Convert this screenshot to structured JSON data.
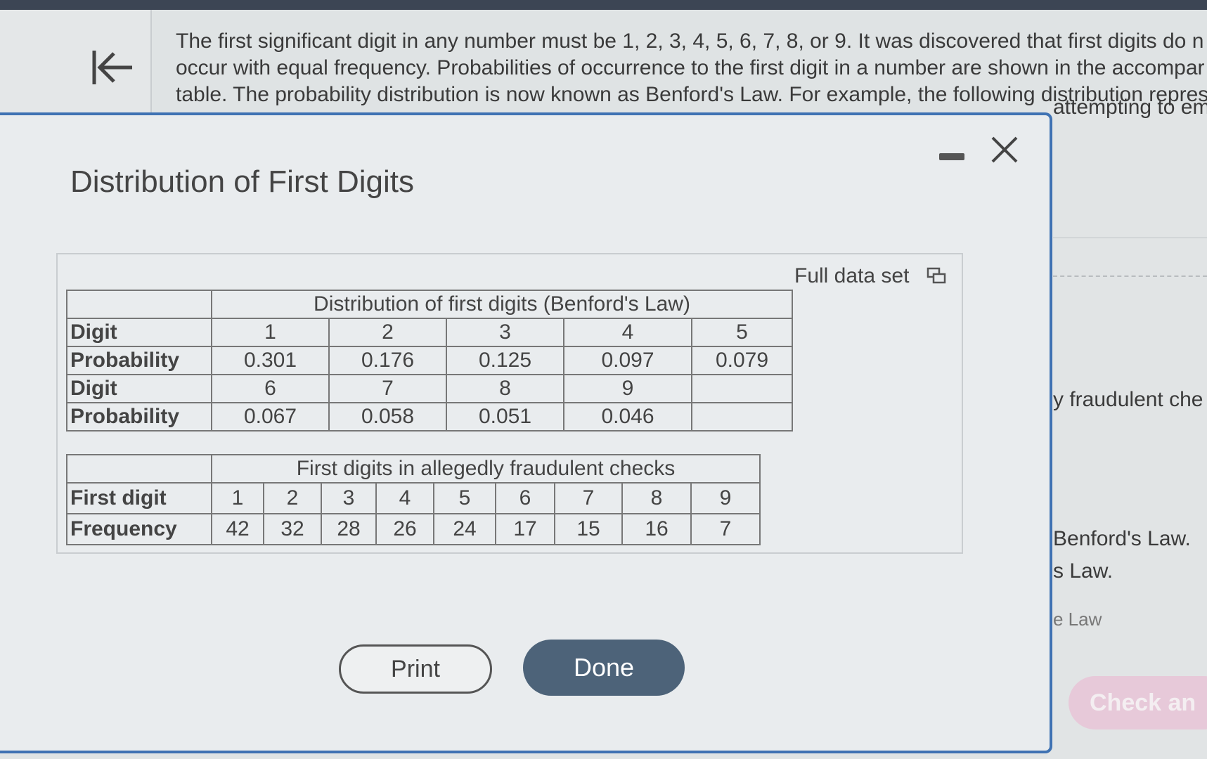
{
  "question": {
    "lines": [
      "The first significant digit in any number must be 1, 2, 3, 4, 5, 6, 7, 8, or 9. It was discovered that first digits do n",
      "occur with equal frequency. Probabilities of occurrence to the first digit in a number are shown in the accompar",
      "table. The probability distribution is now known as Benford's Law. For example, the following distribution repres"
    ]
  },
  "background_right": {
    "attempting": "attempting to em",
    "fraudulent": "y fraudulent che",
    "benford1": "Benford's Law.",
    "benford2": "s Law.",
    "benford3": "e Law",
    "check_button": "Check an"
  },
  "modal": {
    "title": "Distribution of First Digits",
    "full_data_set": "Full data set",
    "print_label": "Print",
    "done_label": "Done"
  },
  "benford_table": {
    "caption": "Distribution of first digits (Benford's Law)",
    "rows": [
      {
        "label": "Digit",
        "cells": [
          "1",
          "2",
          "3",
          "4",
          "5"
        ]
      },
      {
        "label": "Probability",
        "cells": [
          "0.301",
          "0.176",
          "0.125",
          "0.097",
          "0.079"
        ]
      },
      {
        "label": "Digit",
        "cells": [
          "6",
          "7",
          "8",
          "9",
          ""
        ]
      },
      {
        "label": "Probability",
        "cells": [
          "0.067",
          "0.058",
          "0.051",
          "0.046",
          ""
        ]
      }
    ]
  },
  "fraud_table": {
    "caption": "First digits in allegedly fraudulent checks",
    "rows": [
      {
        "label": "First digit",
        "cells": [
          "1",
          "2",
          "3",
          "4",
          "5",
          "6",
          "7",
          "8",
          "9"
        ]
      },
      {
        "label": "Frequency",
        "cells": [
          "42",
          "32",
          "28",
          "26",
          "24",
          "17",
          "15",
          "16",
          "7"
        ]
      }
    ]
  }
}
